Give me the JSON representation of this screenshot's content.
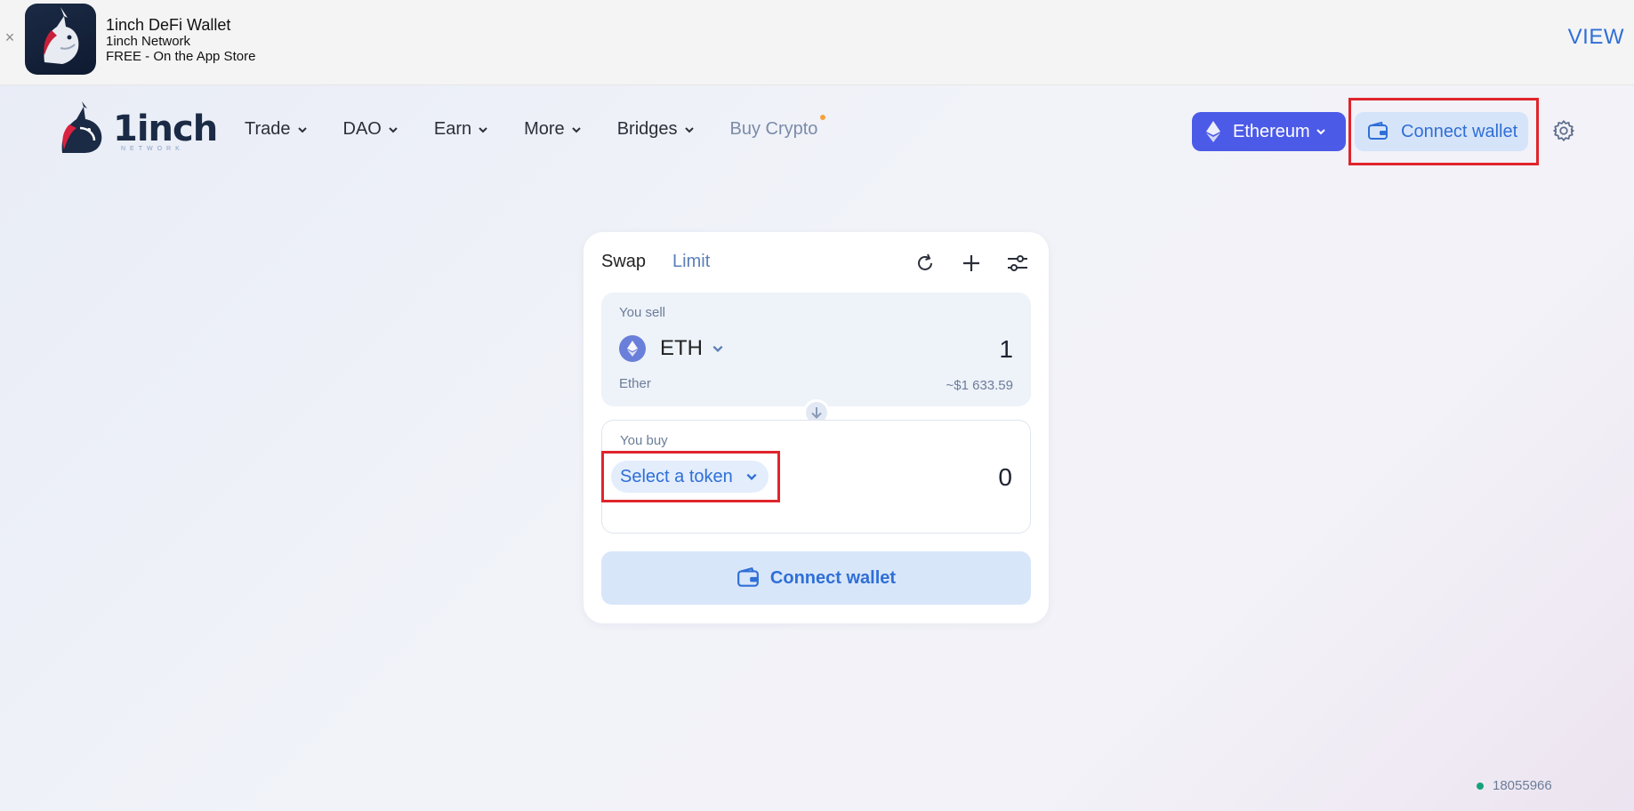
{
  "banner": {
    "close_label": "×",
    "title": "1inch DeFi Wallet",
    "publisher": "1inch Network",
    "price": "FREE - On the App Store",
    "view_label": "VIEW"
  },
  "header": {
    "logo_text": "1inch",
    "logo_sub": "NETWORK",
    "nav": [
      {
        "label": "Trade"
      },
      {
        "label": "DAO"
      },
      {
        "label": "Earn"
      },
      {
        "label": "More"
      },
      {
        "label": "Bridges"
      },
      {
        "label": "Buy Crypto"
      }
    ],
    "network_label": "Ethereum",
    "connect_label": "Connect wallet"
  },
  "swap": {
    "tabs": [
      {
        "label": "Swap",
        "active": true
      },
      {
        "label": "Limit",
        "active": false
      }
    ],
    "sell": {
      "label": "You sell",
      "token_symbol": "ETH",
      "token_name": "Ether",
      "amount": "1",
      "usd_value": "~$1 633.59"
    },
    "buy": {
      "label": "You buy",
      "select_label": "Select a token",
      "amount": "0"
    },
    "connect_label": "Connect wallet"
  },
  "footer": {
    "block_number": "18055966"
  },
  "colors": {
    "accent": "#2f6fd6",
    "network_bg": "#4c5ae8",
    "highlight": "#e0242c",
    "status_ok": "#17a37a"
  }
}
